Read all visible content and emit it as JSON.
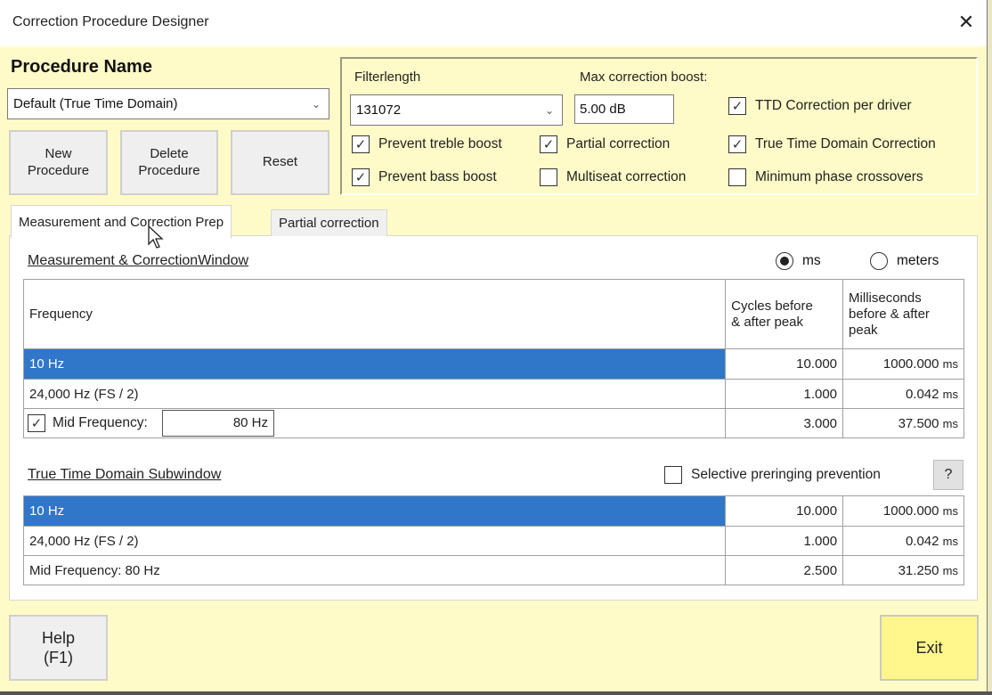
{
  "window": {
    "title": "Correction Procedure Designer",
    "close_icon": "close-icon"
  },
  "procedure": {
    "label": "Procedure Name",
    "selected": "Default (True Time Domain)",
    "buttons": {
      "new": "New Procedure",
      "new_l1": "New",
      "new_l2": "Procedure",
      "del_l1": "Delete",
      "del_l2": "Procedure",
      "reset": "Reset"
    }
  },
  "options": {
    "filterlength_label": "Filterlength",
    "filterlength_value": "131072",
    "max_boost_label": "Max correction boost:",
    "max_boost_value": "5.00 dB",
    "checkboxes": [
      {
        "label": "TTD Correction per driver",
        "checked": true
      },
      {
        "label": "Prevent treble boost",
        "checked": true
      },
      {
        "label": "Partial correction",
        "checked": true
      },
      {
        "label": "True Time Domain Correction",
        "checked": true
      },
      {
        "label": "Prevent bass boost",
        "checked": true
      },
      {
        "label": "Multiseat correction",
        "checked": false
      },
      {
        "label": "Minimum phase crossovers",
        "checked": false
      }
    ]
  },
  "tabs": [
    {
      "label": "Measurement and Correction Prep",
      "active": true
    },
    {
      "label": "Partial correction",
      "active": false
    }
  ],
  "measurement_window": {
    "title": "Measurement & CorrectionWindow",
    "units": [
      {
        "label": "ms",
        "selected": true
      },
      {
        "label": "meters",
        "selected": false
      }
    ],
    "headers": {
      "frequency": "Frequency",
      "cycles_l1": "Cycles before",
      "cycles_l2": "& after peak",
      "ms_l1": "Milliseconds",
      "ms_l2": "before & after",
      "ms_l3": "peak"
    },
    "rows": [
      {
        "frequency": "10 Hz",
        "cycles": "10.000",
        "ms": "1000.000",
        "unit": "ms",
        "selected": true
      },
      {
        "frequency": "24,000 Hz (FS / 2)",
        "cycles": "1.000",
        "ms": "0.042",
        "unit": "ms",
        "selected": false
      },
      {
        "frequency": "Mid Frequency:",
        "mid_checked": true,
        "mid_value": "80 Hz",
        "cycles": "3.000",
        "ms": "37.500",
        "unit": "ms",
        "selected": false
      }
    ]
  },
  "ttd_subwindow": {
    "title": "True Time Domain Subwindow",
    "preringing_label": "Selective preringing prevention",
    "preringing_checked": false,
    "help_label": "?",
    "rows": [
      {
        "frequency": "10 Hz",
        "cycles": "10.000",
        "ms": "1000.000",
        "unit": "ms",
        "selected": true
      },
      {
        "frequency": "24,000 Hz (FS / 2)",
        "cycles": "1.000",
        "ms": "0.042",
        "unit": "ms",
        "selected": false
      },
      {
        "frequency": "Mid Frequency: 80 Hz",
        "cycles": "2.500",
        "ms": "31.250",
        "unit": "ms",
        "selected": false
      }
    ]
  },
  "footer": {
    "help_l1": "Help",
    "help_l2": "(F1)",
    "exit": "Exit"
  },
  "colors": {
    "background": "#fffbc8",
    "selection": "#3076c9",
    "exit_button": "#fff68c"
  }
}
